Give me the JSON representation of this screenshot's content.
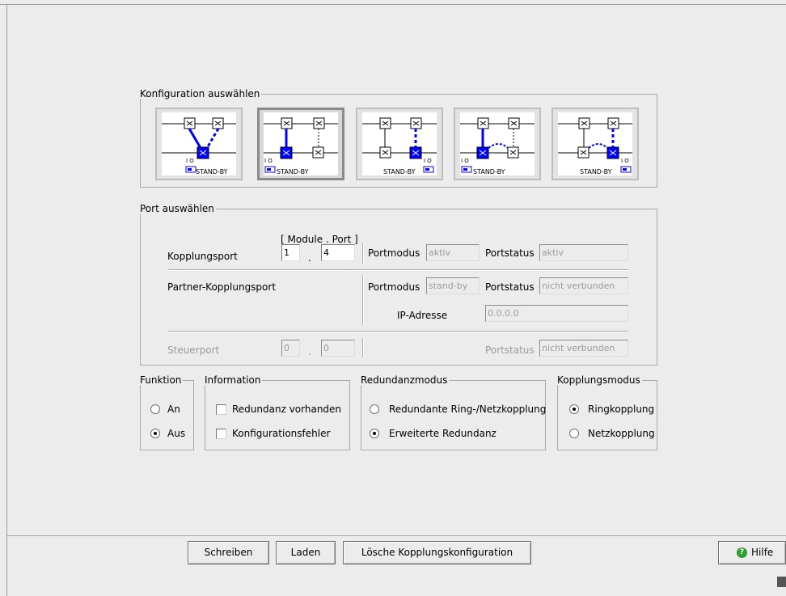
{
  "config_group": {
    "legend": "Konfiguration auswählen",
    "options": [
      {
        "label": "STAND-BY",
        "switch_label": "I O"
      },
      {
        "label": "STAND-BY",
        "switch_label": "I O"
      },
      {
        "label": "STAND-BY",
        "switch_label": "I O"
      },
      {
        "label": "STAND-BY",
        "switch_label": "I O"
      },
      {
        "label": "STAND-BY",
        "switch_label": "I O"
      }
    ],
    "selected_index": 1
  },
  "port_group": {
    "legend": "Port auswählen",
    "module_port_header": "[ Module . Port ]",
    "kopplungsport_label": "Kopplungsport",
    "kopplungsport_module": "1",
    "kopplungsport_port": "4",
    "dot": ".",
    "portmodus_label": "Portmodus",
    "portmodus_value": "aktiv",
    "portstatus_label": "Portstatus",
    "portstatus_value": "aktiv",
    "partner_label": "Partner-Kopplungsport",
    "partner_portmodus_value": "stand-by",
    "partner_portstatus_value": "nicht verbunden",
    "ip_label": "IP-Adresse",
    "ip_value": "0.0.0.0",
    "steuerport_label": "Steuerport",
    "steuerport_module": "0",
    "steuerport_port": "0",
    "steuerport_portstatus_value": "nicht verbunden"
  },
  "funktion": {
    "legend": "Funktion",
    "options": [
      "An",
      "Aus"
    ],
    "selected": "Aus"
  },
  "information": {
    "legend": "Information",
    "items": [
      "Redundanz vorhanden",
      "Konfigurationsfehler"
    ]
  },
  "redundanzmodus": {
    "legend": "Redundanzmodus",
    "options": [
      "Redundante Ring-/Netzkopplung",
      "Erweiterte Redundanz"
    ],
    "selected": "Erweiterte Redundanz"
  },
  "kopplungsmodus": {
    "legend": "Kopplungsmodus",
    "options": [
      "Ringkopplung",
      "Netzkopplung"
    ],
    "selected": "Ringkopplung"
  },
  "buttons": {
    "write": "Schreiben",
    "load": "Laden",
    "delete": "Lösche Kopplungskonfiguration",
    "help": "Hilfe"
  },
  "colors": {
    "accent": "#0000ff",
    "background": "#ececec"
  }
}
